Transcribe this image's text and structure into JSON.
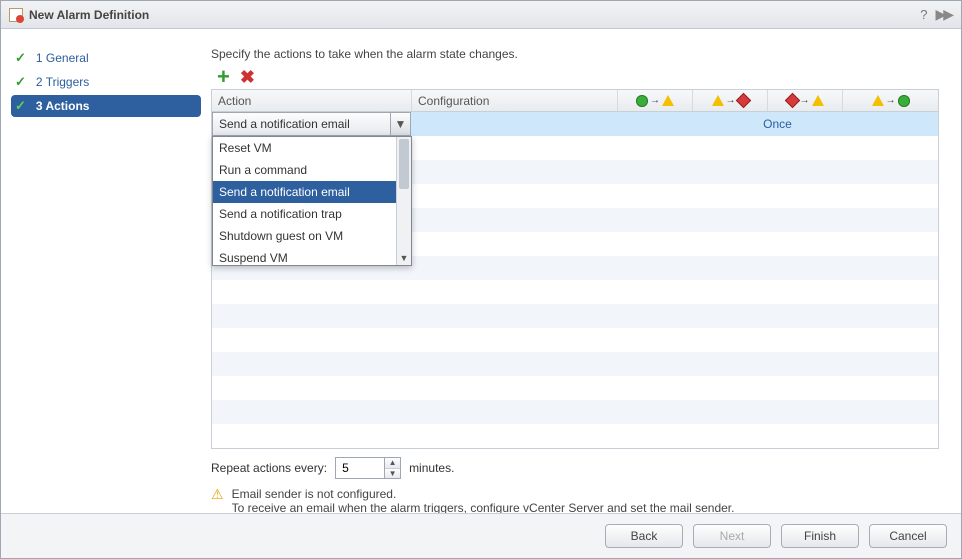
{
  "window": {
    "title": "New Alarm Definition"
  },
  "sidebar": {
    "steps": [
      {
        "label": "1  General",
        "done": true,
        "active": false
      },
      {
        "label": "2  Triggers",
        "done": true,
        "active": false
      },
      {
        "label": "3  Actions",
        "done": true,
        "active": true
      }
    ]
  },
  "main": {
    "instruction": "Specify the actions to take when the alarm state changes.",
    "columns": {
      "action": "Action",
      "configuration": "Configuration"
    },
    "action_select": {
      "value": "Send a notification email",
      "options": [
        "Reset VM",
        "Run a command",
        "Send a notification email",
        "Send a notification trap",
        "Shutdown guest on VM",
        "Suspend VM"
      ],
      "selected_index": 2
    },
    "row_frequency": "Once",
    "repeat": {
      "label": "Repeat actions every:",
      "value": "5",
      "unit": "minutes."
    },
    "warning": {
      "line1": "Email sender is not configured.",
      "line2": "To receive an email when the alarm triggers, configure vCenter Server and set the mail sender."
    }
  },
  "footer": {
    "back": "Back",
    "next": "Next",
    "finish": "Finish",
    "cancel": "Cancel"
  }
}
